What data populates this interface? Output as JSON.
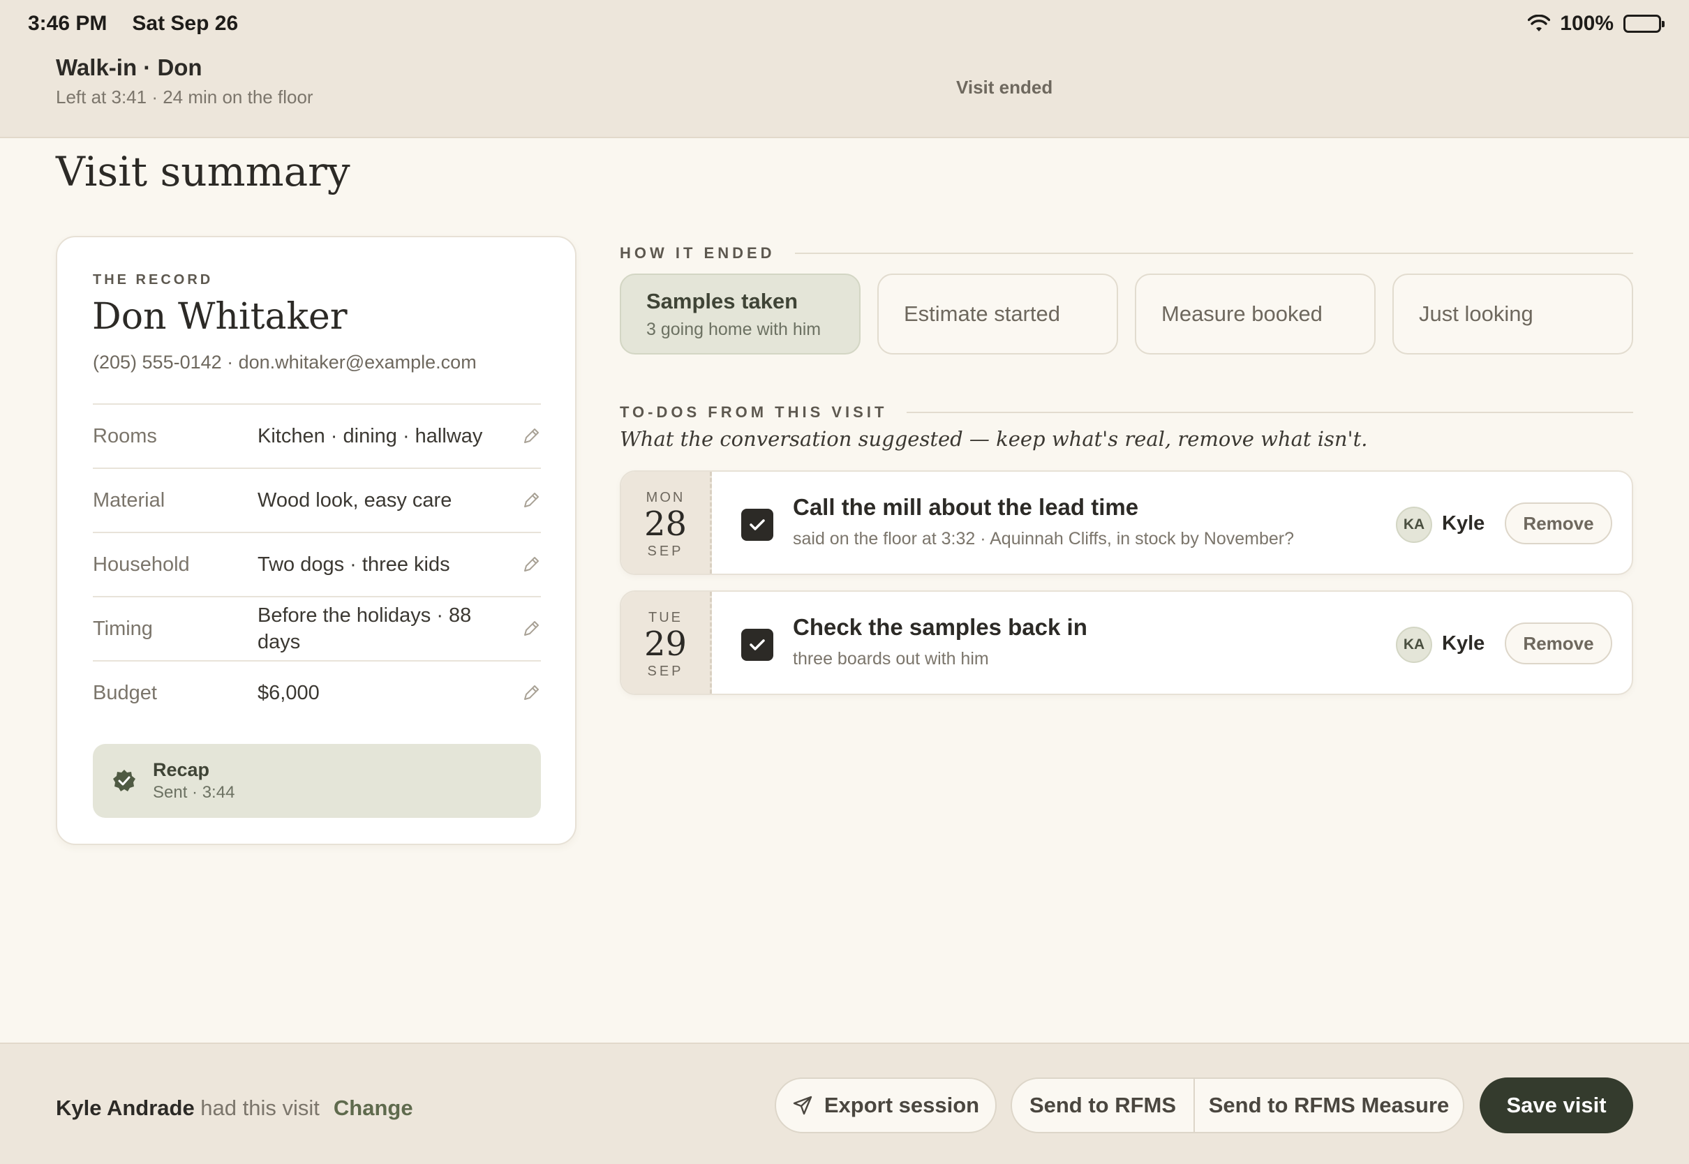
{
  "status": {
    "time": "3:46 PM",
    "date": "Sat Sep 26",
    "battery": "100%"
  },
  "header": {
    "title": "Walk-in · Don",
    "subtitle": "Left at 3:41 · 24 min on the floor",
    "state": "Visit ended"
  },
  "page_title": "Visit summary",
  "record": {
    "eyebrow": "THE RECORD",
    "name": "Don Whitaker",
    "contact": "(205) 555-0142 · don.whitaker@example.com",
    "rows": [
      {
        "label": "Rooms",
        "value": "Kitchen · dining · hallway"
      },
      {
        "label": "Material",
        "value": "Wood look, easy care"
      },
      {
        "label": "Household",
        "value": "Two dogs · three kids"
      },
      {
        "label": "Timing",
        "value": "Before the holidays · 88 days"
      },
      {
        "label": "Budget",
        "value": "$6,000"
      }
    ],
    "recap": {
      "title": "Recap",
      "status": "Sent · 3:44"
    }
  },
  "how_it_ended": {
    "heading": "HOW IT ENDED",
    "options": [
      {
        "label": "Samples taken",
        "sub": "3 going home with him",
        "selected": true
      },
      {
        "label": "Estimate started"
      },
      {
        "label": "Measure booked"
      },
      {
        "label": "Just looking"
      }
    ]
  },
  "todos": {
    "heading": "TO-DOS FROM THIS VISIT",
    "subheading": "What the conversation suggested — keep what's real, remove what isn't.",
    "items": [
      {
        "dow": "MON",
        "day": "28",
        "month": "SEP",
        "title": "Call the mill about the lead time",
        "detail": "said on the floor at 3:32 · Aquinnah Cliffs, in stock by November?",
        "initials": "KA",
        "owner": "Kyle",
        "remove": "Remove",
        "checked": true
      },
      {
        "dow": "TUE",
        "day": "29",
        "month": "SEP",
        "title": "Check the samples back in",
        "detail": "three boards out with him",
        "initials": "KA",
        "owner": "Kyle",
        "remove": "Remove",
        "checked": true
      }
    ]
  },
  "footer": {
    "owner_name": "Kyle Andrade",
    "owner_suffix": " had this visit",
    "change": "Change",
    "export": "Export session",
    "send_rfms": "Send to RFMS",
    "send_measure": "Send to RFMS Measure",
    "save": "Save visit"
  },
  "colors": {
    "accent": "#343b2d",
    "selected_bg": "#e4e5d8",
    "band_bg": "#ede6db",
    "page_bg": "#faf7f0"
  }
}
